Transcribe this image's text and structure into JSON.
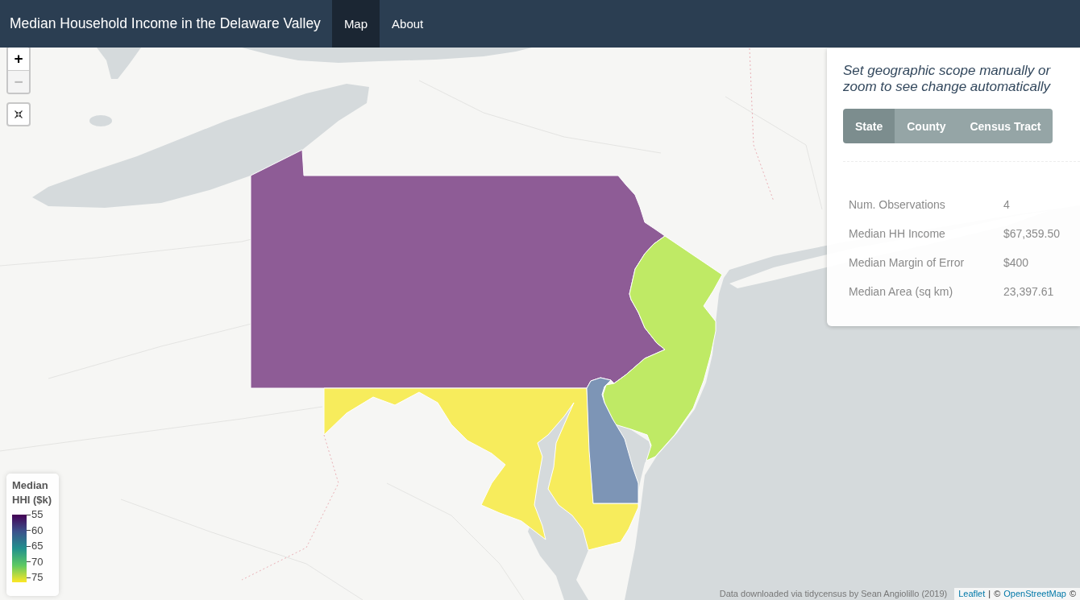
{
  "navbar": {
    "title": "Median Household Income in the Delaware Valley",
    "tabs": [
      {
        "label": "Map",
        "selected": true
      },
      {
        "label": "About",
        "selected": false
      }
    ]
  },
  "map": {
    "zoom_buttons": [
      {
        "label": "+",
        "disabled": false
      },
      {
        "label": "−",
        "disabled": true
      }
    ],
    "regions": [
      {
        "color": "#8e5c96"
      },
      {
        "color": "#bfea65"
      },
      {
        "color": "#f7ec5c"
      },
      {
        "color": "#7d95b6"
      }
    ]
  },
  "scope_panel": {
    "heading": "Set geographic scope manually or zoom to see change automatically",
    "scopes": [
      {
        "label": "State",
        "selected": true
      },
      {
        "label": "County",
        "selected": false
      },
      {
        "label": "Census Tract",
        "selected": false
      }
    ],
    "stats": [
      {
        "label": "Num. Observations",
        "value": "4"
      },
      {
        "label": "Median HH Income",
        "value": "$67,359.50"
      },
      {
        "label": "Median Margin of Error",
        "value": "$400"
      },
      {
        "label": "Median Area (sq km)",
        "value": "23,397.61"
      }
    ]
  },
  "legend": {
    "title": "Median HHI ($k)",
    "ticks": [
      "55",
      "60",
      "65",
      "70",
      "75"
    ]
  },
  "attribution": {
    "note": "Data downloaded via tidycensus by Sean Angiolillo (2019)",
    "parts": [
      {
        "kind": "link",
        "text": "Leaflet"
      },
      {
        "kind": "text",
        "text": "|"
      },
      {
        "kind": "text",
        "text": "©"
      },
      {
        "kind": "link",
        "text": "OpenStreetMap"
      },
      {
        "kind": "text",
        "text": "©"
      }
    ]
  }
}
